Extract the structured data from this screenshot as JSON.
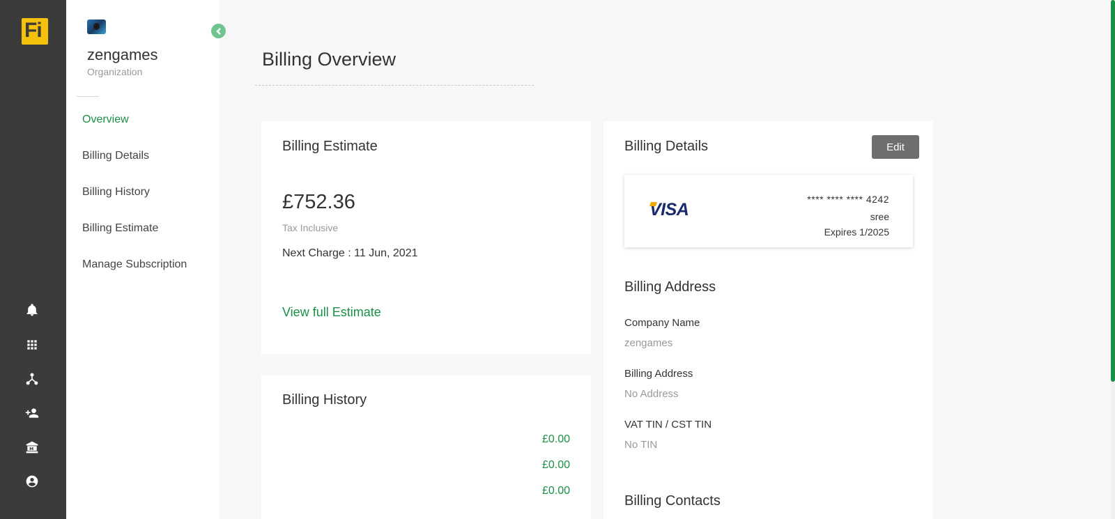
{
  "logo_text": "Fi",
  "org": {
    "name": "zengames",
    "subtitle": "Organization"
  },
  "nav": {
    "items": [
      {
        "label": "Overview",
        "active": true
      },
      {
        "label": "Billing Details",
        "active": false
      },
      {
        "label": "Billing History",
        "active": false
      },
      {
        "label": "Billing Estimate",
        "active": false
      },
      {
        "label": "Manage Subscription",
        "active": false
      }
    ]
  },
  "rail_icons": [
    "bell-icon",
    "apps-grid-icon",
    "hierarchy-icon",
    "add-user-icon",
    "bank-icon",
    "account-circle-icon"
  ],
  "page": {
    "title": "Billing Overview"
  },
  "estimate": {
    "title": "Billing Estimate",
    "amount": "£752.36",
    "tax_note": "Tax Inclusive",
    "next_charge": "Next Charge : 11 Jun, 2021",
    "link": "View full Estimate"
  },
  "history": {
    "title": "Billing History",
    "amounts": [
      "£0.00",
      "£0.00",
      "£0.00"
    ]
  },
  "details": {
    "title": "Billing Details",
    "edit_label": "Edit",
    "card": {
      "brand": "VISA",
      "number": "**** **** **** 4242",
      "holder": "sree",
      "expiry": "Expires 1/2025"
    },
    "address_title": "Billing Address",
    "fields": [
      {
        "label": "Company Name",
        "value": "zengames"
      },
      {
        "label": "Billing Address",
        "value": "No Address"
      },
      {
        "label": "VAT TIN / CST TIN",
        "value": "No TIN"
      }
    ],
    "contacts_title": "Billing Contacts"
  },
  "colors": {
    "accent_green": "#1a8f47",
    "rail_bg": "#3b3b3b",
    "logo_yellow": "#f4c20d",
    "edit_button": "#6e6e6e"
  }
}
